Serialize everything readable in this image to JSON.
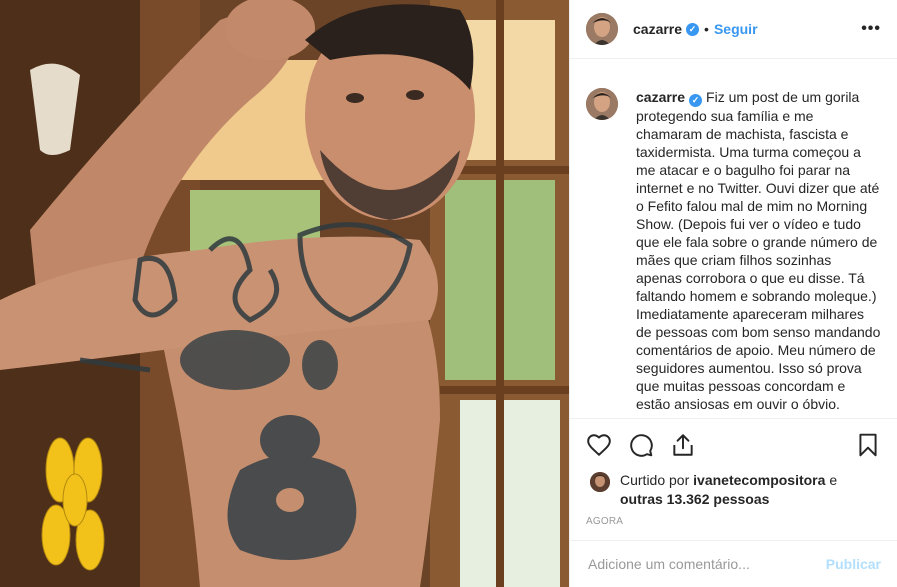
{
  "post": {
    "author": "cazarre",
    "verified_icon": "verified-badge-icon",
    "follow_label": "Seguir",
    "separator": "•",
    "more_label": "•••",
    "photo_description_icon": "post-photo"
  },
  "caption": {
    "username": "cazarre",
    "text": "Fiz um post de um gorila protegendo sua família e me chamaram de machista, fascista e taxidermista. Uma turma começou a me atacar e o bagulho foi parar na internet e no Twitter. Ouvi dizer que até o Fefito falou mal de mim no Morning Show. (Depois fui ver o vídeo e tudo que ele fala sobre o grande número de mães que criam filhos sozinhas apenas corrobora o que eu disse. Tá faltando homem e sobrando moleque.) Imediatamente apareceram milhares de pessoas com bom senso mandando comentários de apoio. Meu número de seguidores aumentou. Isso só prova que muitas pessoas concordam e estão ansiosas em ouvir o óbvio."
  },
  "actions": {
    "like_icon": "heart-icon",
    "comment_icon": "comment-icon",
    "share_icon": "share-icon",
    "save_icon": "bookmark-icon"
  },
  "likes": {
    "prefix": "Curtido por",
    "liker": "ivanetecompositora",
    "and": "e",
    "others": "outras 13.362 pessoas"
  },
  "timestamp": "AGORA",
  "comment_box": {
    "placeholder": "Adicione um comentário...",
    "publish_label": "Publicar"
  },
  "colors": {
    "link_blue": "#3897f0",
    "publish_disabled": "#b2dffc",
    "border": "#efefef",
    "text": "#262626",
    "muted": "#999999"
  }
}
